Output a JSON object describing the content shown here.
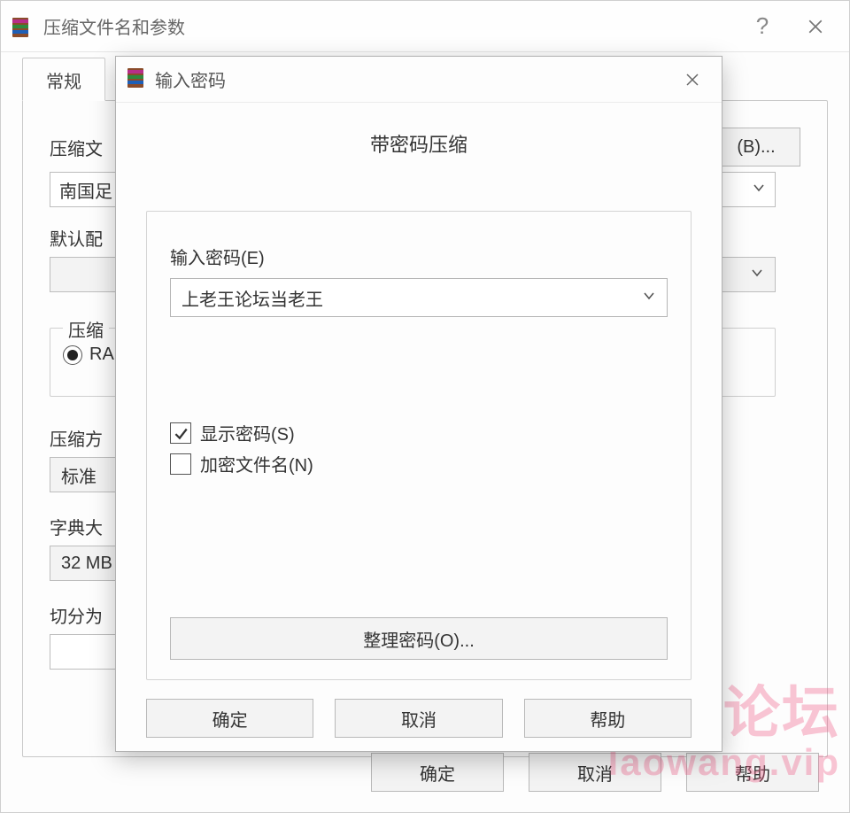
{
  "main": {
    "title": "压缩文件名和参数",
    "help_char": "?",
    "tabs": {
      "general": "常规"
    },
    "labels": {
      "filename": "压缩文",
      "default_profile": "默认配",
      "archive_format_legend": "压缩",
      "method": "压缩方",
      "method_value": "标准",
      "dict": "字典大",
      "dict_value": "32 MB",
      "split": "切分为"
    },
    "filename_value": "南国足",
    "radio_rar": "RA",
    "browse_btn": "(B)...",
    "buttons": {
      "ok": "确定",
      "cancel": "取消",
      "help": "帮助"
    }
  },
  "pwd": {
    "title": "输入密码",
    "heading": "带密码压缩",
    "input_label": "输入密码(E)",
    "input_value": "上老王论坛当老王",
    "show_password": "显示密码(S)",
    "encrypt_names": "加密文件名(N)",
    "organize": "整理密码(O)...",
    "buttons": {
      "ok": "确定",
      "cancel": "取消",
      "help": "帮助"
    }
  },
  "watermark": {
    "line1": "老王论坛",
    "line2": "laowang.vip"
  }
}
